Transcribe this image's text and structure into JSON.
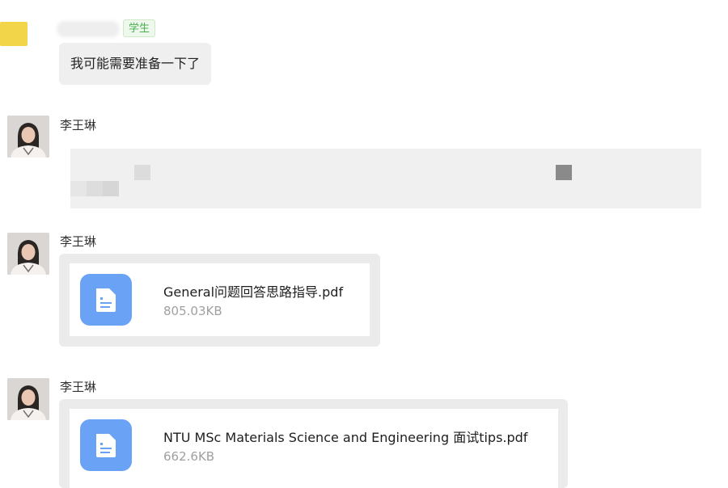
{
  "messages": [
    {
      "role_badge": "学生",
      "text": "我可能需要准备一下了"
    },
    {
      "sender": "李王琳"
    },
    {
      "sender": "李王琳",
      "file": {
        "name": "General问题回答思路指导.pdf",
        "size": "805.03KB"
      }
    },
    {
      "sender": "李王琳",
      "file": {
        "name": "NTU MSc Materials Science and Engineering 面试tips.pdf",
        "size": "662.6KB"
      }
    }
  ],
  "colors": {
    "file_icon": "#6aa3f5",
    "badge_text": "#4caf50",
    "bubble": "#efefef"
  }
}
